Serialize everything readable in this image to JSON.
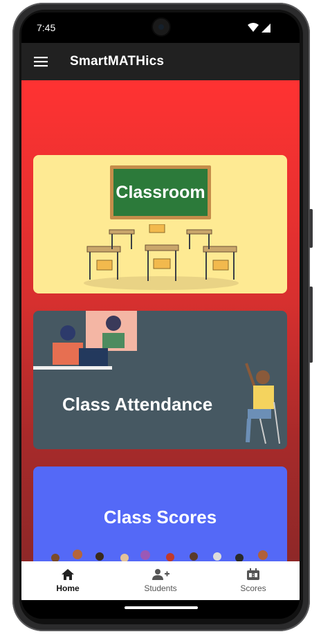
{
  "status_bar": {
    "time": "7:45"
  },
  "app_bar": {
    "title": "SmartMATHics"
  },
  "cards": {
    "classroom": {
      "label": "Classroom"
    },
    "attendance": {
      "label": "Class Attendance"
    },
    "scores": {
      "label": "Class Scores"
    }
  },
  "bottom_nav": {
    "items": [
      {
        "label": "Home",
        "icon": "home-icon",
        "active": true
      },
      {
        "label": "Students",
        "icon": "add-person-icon",
        "active": false
      },
      {
        "label": "Scores",
        "icon": "scoreboard-icon",
        "active": false
      }
    ]
  },
  "colors": {
    "app_bar": "#212121",
    "gradient_top": "#ff3232",
    "gradient_bottom": "#8e2828",
    "classroom_card": "#feea93",
    "attendance_card": "#465862",
    "scores_card": "#5469f7"
  }
}
